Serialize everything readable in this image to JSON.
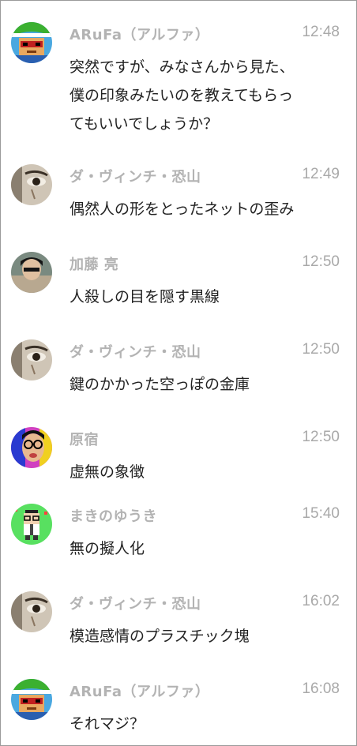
{
  "messages": [
    {
      "avatar": "arufa-avatar",
      "name": "ARuFa（アルファ）",
      "time": "12:48",
      "lines": [
        "突然ですが、みなさんから見た、",
        "僕の印象みたいのを教えてもらっ",
        "てもいいでしょうか？"
      ]
    },
    {
      "avatar": "davinci-avatar",
      "name": "ダ・ヴィンチ・恐山",
      "time": "12:49",
      "lines": [
        "偶然人の形をとったネットの歪み"
      ]
    },
    {
      "avatar": "kato-avatar",
      "name": "加藤 亮",
      "time": "12:50",
      "lines": [
        "人殺しの目を隠す黒線"
      ]
    },
    {
      "avatar": "davinci-avatar",
      "name": "ダ・ヴィンチ・恐山",
      "time": "12:50",
      "lines": [
        "鍵のかかった空っぽの金庫"
      ]
    },
    {
      "avatar": "harajuku-avatar",
      "name": "原宿",
      "time": "12:50",
      "lines": [
        "虚無の象徴"
      ]
    },
    {
      "avatar": "makino-avatar",
      "name": "まきのゆうき",
      "time": "15:40",
      "lines": [
        "無の擬人化"
      ]
    },
    {
      "avatar": "davinci-avatar",
      "name": "ダ・ヴィンチ・恐山",
      "time": "16:02",
      "lines": [
        "模造感情のプラスチック塊"
      ]
    },
    {
      "avatar": "arufa-avatar",
      "name": "ARuFa（アルファ）",
      "time": "16:08",
      "lines": [
        "それマジ？"
      ]
    }
  ],
  "colors": {
    "name": "#b3b3b3",
    "time": "#a9a9a9",
    "text": "#222222",
    "border": "#9a9a9a"
  }
}
